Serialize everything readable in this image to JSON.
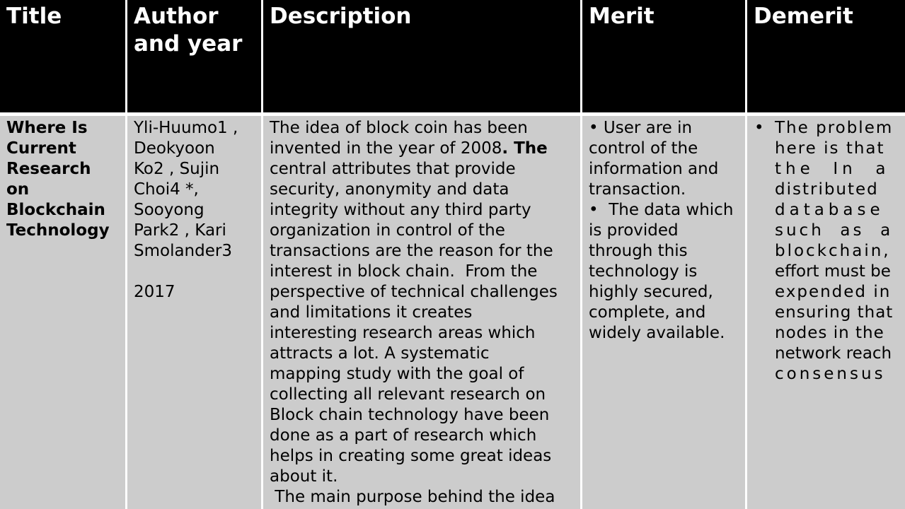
{
  "table": {
    "headers": [
      [
        "Title"
      ],
      [
        "Author",
        "and year"
      ],
      [
        "Description"
      ],
      [
        "Merit"
      ],
      [
        "Demerit"
      ]
    ],
    "row": {
      "title_lines": [
        "Where Is",
        "Current",
        "Research",
        "on",
        "Blockchain",
        "Technology"
      ],
      "authors_lines": [
        "Yli-Huumo1 ,",
        "Deokyoon",
        "Ko2 , Sujin",
        "Choi4 *,",
        "Sooyong",
        "Park2 , Kari",
        "Smolander3"
      ],
      "year": "2017",
      "description_lines": [
        "The idea of block coin has been",
        "invented in the year of 2008",
        "central attributes that provide",
        "security, anonymity and data",
        "integrity without any third party",
        "organization in control of the",
        "transactions are the reason for the",
        "interest in block chain.  From the",
        "perspective of technical challenges",
        "and limitations it creates",
        "interesting research areas which",
        "attracts a lot. A systematic",
        "mapping study with the goal of",
        "collecting all relevant research on",
        "Block chain technology have been",
        "done as a part of research which",
        "helps in creating some great ideas",
        "about it.",
        " The main purpose behind the idea"
      ],
      "description_bold_fragment": ". The",
      "merit_lines": [
        "• User are in",
        "control of the",
        "information and",
        "transaction.",
        "•  The data which",
        "is provided",
        "through this",
        "technology is",
        "highly secured,",
        "complete, and",
        "widely available."
      ],
      "demerit_bullet": "•",
      "demerit_lines": [
        "The problem",
        "here is that",
        "the  In  a",
        "distributed",
        "database",
        "such  as  a",
        "blockchain,",
        "effort must be",
        "expended in",
        "ensuring that",
        "nodes in the",
        "network reach",
        "consensus"
      ]
    }
  }
}
